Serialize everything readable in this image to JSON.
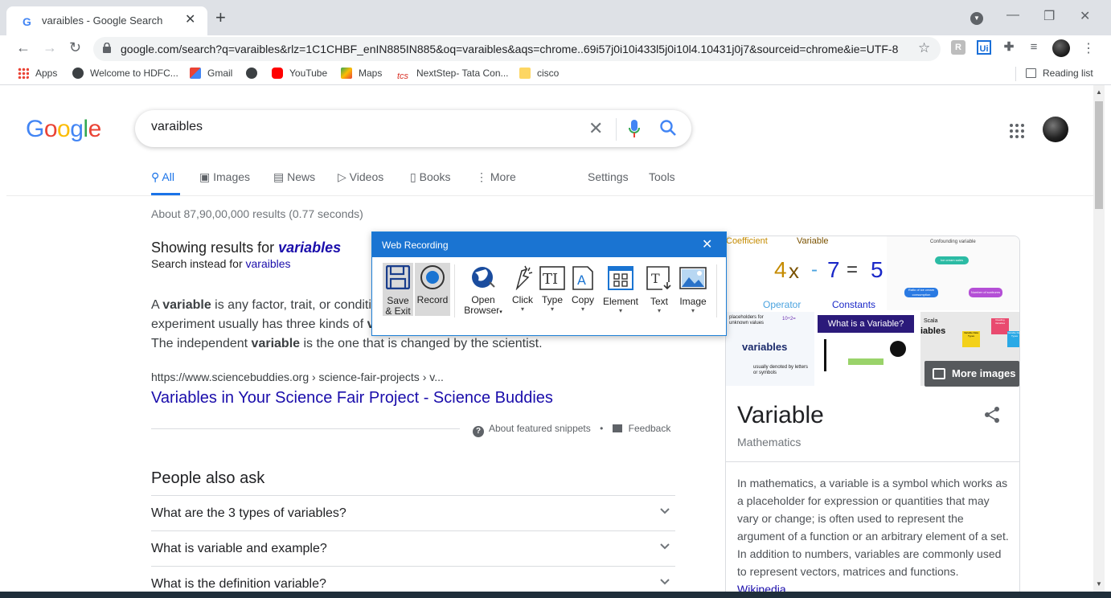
{
  "browser": {
    "tab_title": "varaibles - Google Search",
    "url": "google.com/search?q=varaibles&rlz=1C1CHBF_enIN885IN885&oq=varaibles&aqs=chrome..69i57j0i10i433l5j0i10l4.10431j0j7&sourceid=chrome&ie=UTF-8",
    "bookmarks": [
      "Apps",
      "Welcome to HDFC...",
      "Gmail",
      "YouTube",
      "Maps",
      "NextStep- Tata Con...",
      "cisco"
    ],
    "reading_list": "Reading list"
  },
  "search": {
    "query": "varaibles",
    "tabs": [
      "All",
      "Images",
      "News",
      "Videos",
      "Books",
      "More"
    ],
    "settings": "Settings",
    "tools": "Tools",
    "stats": "About 87,90,00,000 results (0.77 seconds)",
    "showing_prefix": "Showing results for ",
    "showing_term": "variables",
    "instead_prefix": "Search instead for ",
    "instead_term": "varaibles"
  },
  "featured": {
    "lines": [
      [
        "A ",
        "variable",
        " is any factor, trait, or conditi"
      ],
      [
        "experiment usually has three kinds of ",
        "v",
        ""
      ],
      [
        "The independent ",
        "variable",
        " is the one that is changed by the scientist."
      ]
    ],
    "cite": "https://www.sciencebuddies.org › science-fair-projects › v...",
    "title": "Variables in Your Science Fair Project - Science Buddies",
    "about": "About featured snippets",
    "bullet": "•",
    "feedback": "Feedback"
  },
  "paa": {
    "title": "People also ask",
    "questions": [
      "What are the 3 types of variables?",
      "What is variable and example?",
      "What is the definition variable?"
    ]
  },
  "knowledge_panel": {
    "title": "Variable",
    "subtitle": "Mathematics",
    "description": "In mathematics, a variable is a symbol which works as a placeholder for expression or quantities that may vary or change; is often used to represent the argument of a function or an arbitrary element of a set. In addition to numbers, variables are commonly used to represent vectors, matrices and functions.",
    "source": "Wikipedia",
    "more_images": "More images",
    "img1": {
      "coefficient": "Coefficient",
      "variable": "Variable",
      "four": "4",
      "x": "x",
      "minus": "-",
      "seven": "7",
      "equals": "=",
      "five": "5",
      "operator": "Operator",
      "constants": "Constants"
    },
    "img2": {
      "title": "Confounding variable",
      "top": "Ice cream sales",
      "left": "Ratio of ice cream consumption",
      "right": "Number of sunburns"
    },
    "img3": {
      "top": "placeholders for unknown values",
      "expr": "10÷2=",
      "mid": "variables",
      "bottom": "usually denoted by letters or symbols"
    },
    "img4": {
      "title": "What is a Variable?"
    },
    "img5": {
      "scala": "Scala",
      "text": "iables",
      "a": "Variable Data Types",
      "b": "Reading Variables",
      "c": "Variable Data Types"
    }
  },
  "recorder": {
    "title": "Web Recording",
    "buttons": {
      "save": [
        "Save",
        "& Exit"
      ],
      "record": "Record",
      "open": [
        "Open",
        "Browser"
      ],
      "click": "Click",
      "type": "Type",
      "copy": "Copy",
      "element": "Element",
      "text": "Text",
      "image": "Image"
    }
  },
  "colors": {
    "accent": "#1a73e8",
    "link": "#1a0dab",
    "recorder_header": "#1a74d2"
  }
}
